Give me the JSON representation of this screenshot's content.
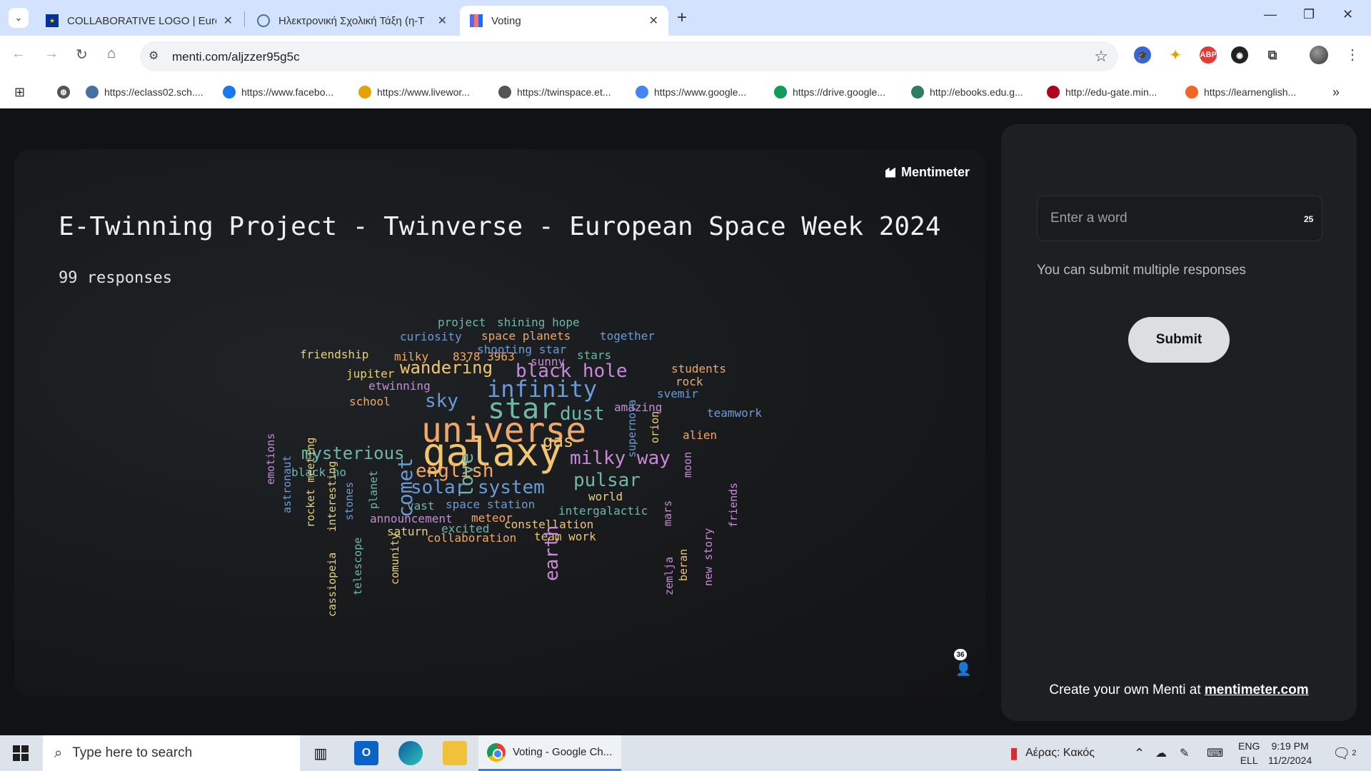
{
  "browser": {
    "tabs": [
      {
        "title": "COLLABORATIVE LOGO | Europ",
        "favicon": "eu-flag-icon",
        "active": false
      },
      {
        "title": "Ηλεκτρονική Σχολική Τάξη (η-Τ",
        "favicon": "eclass-icon",
        "active": false
      },
      {
        "title": "Voting",
        "favicon": "mentimeter-icon",
        "active": true
      }
    ],
    "url": "menti.com/aljzzer95g5c",
    "bookmarks": [
      {
        "label": "https://eclass02.sch....",
        "icon": "eclass-icon",
        "color": "#4a6fa5"
      },
      {
        "label": "https://www.facebo...",
        "icon": "facebook-icon",
        "color": "#1877f2"
      },
      {
        "label": "https://www.livewor...",
        "icon": "liveworksheets-icon",
        "color": "#e5a100"
      },
      {
        "label": "https://twinspace.et...",
        "icon": "twinspace-icon",
        "color": "#555555"
      },
      {
        "label": "https://www.google...",
        "icon": "google-icon",
        "color": "#4285f4"
      },
      {
        "label": "https://drive.google...",
        "icon": "drive-icon",
        "color": "#0f9d58"
      },
      {
        "label": "http://ebooks.edu.g...",
        "icon": "ebooks-icon",
        "color": "#2e7d60"
      },
      {
        "label": "http://edu-gate.min...",
        "icon": "edugate-icon",
        "color": "#b00020"
      },
      {
        "label": "https://learnenglish...",
        "icon": "learnenglish-icon",
        "color": "#f26522"
      }
    ]
  },
  "menti": {
    "logo": "Mentimeter",
    "question": "E-Twinning Project - Twinverse - European Space Week 2024",
    "responses": "99 responses",
    "audience_count": "36",
    "input_placeholder": "Enter a word",
    "char_limit": "25",
    "hint": "You can submit multiple responses",
    "submit": "Submit",
    "create_prefix": "Create your own Menti at ",
    "create_link": "mentimeter.com"
  },
  "wordcloud": [
    {
      "t": "project",
      "c": "#6fb8a8",
      "s": 16
    },
    {
      "t": "shining hope",
      "c": "#6fb8a8",
      "s": 16
    },
    {
      "t": "space planets",
      "c": "#f0a868",
      "s": 16
    },
    {
      "t": "curiosity",
      "c": "#6a9bd8",
      "s": 16
    },
    {
      "t": "together",
      "c": "#6a9bd8",
      "s": 16
    },
    {
      "t": "shooting star",
      "c": "#6a9bd8",
      "s": 16
    },
    {
      "t": "friendship",
      "c": "#e8d07a",
      "s": 16
    },
    {
      "t": "milky",
      "c": "#f0a868",
      "s": 16
    },
    {
      "t": "8378 3963",
      "c": "#f0a868",
      "s": 16
    },
    {
      "t": "sunny",
      "c": "#c88ad8",
      "s": 16
    },
    {
      "t": "stars",
      "c": "#6fb8a8",
      "s": 16
    },
    {
      "t": "jupiter",
      "c": "#e8d07a",
      "s": 16
    },
    {
      "t": "wandering",
      "c": "#f2c66e",
      "s": 24
    },
    {
      "t": "black hole",
      "c": "#c88ad8",
      "s": 26
    },
    {
      "t": "students",
      "c": "#f0a868",
      "s": 16
    },
    {
      "t": "etwinning",
      "c": "#c88ad8",
      "s": 16
    },
    {
      "t": "infinity",
      "c": "#6a9bd8",
      "s": 32
    },
    {
      "t": "rock",
      "c": "#f0a868",
      "s": 16
    },
    {
      "t": "svemir",
      "c": "#6a9bd8",
      "s": 16
    },
    {
      "t": "school",
      "c": "#f0a868",
      "s": 16
    },
    {
      "t": "sky",
      "c": "#6a9bd8",
      "s": 26
    },
    {
      "t": "star",
      "c": "#6fb8a8",
      "s": 40
    },
    {
      "t": "amazing",
      "c": "#c88ad8",
      "s": 16
    },
    {
      "t": "dust",
      "c": "#6fb8a8",
      "s": 26
    },
    {
      "t": "teamwork",
      "c": "#6a9bd8",
      "s": 16
    },
    {
      "t": "universe",
      "c": "#f0a868",
      "s": 48
    },
    {
      "t": "gas",
      "c": "#f2c66e",
      "s": 24
    },
    {
      "t": "alien",
      "c": "#f0a868",
      "s": 16
    },
    {
      "t": "galaxy",
      "c": "#f2c66e",
      "s": 54
    },
    {
      "t": "mysterious",
      "c": "#6fb8a8",
      "s": 24
    },
    {
      "t": "milky way",
      "c": "#c88ad8",
      "s": 26
    },
    {
      "t": "english",
      "c": "#f0a868",
      "s": 26
    },
    {
      "t": "black ho",
      "c": "#6fb8a8",
      "s": 16
    },
    {
      "t": "pulsar",
      "c": "#6fb8a8",
      "s": 26
    },
    {
      "t": "solar system",
      "c": "#6a9bd8",
      "s": 26
    },
    {
      "t": "world",
      "c": "#e8d07a",
      "s": 16
    },
    {
      "t": "space station",
      "c": "#6a9bd8",
      "s": 16
    },
    {
      "t": "vast",
      "c": "#6fb8a8",
      "s": 16
    },
    {
      "t": "intergalactic",
      "c": "#6fb8a8",
      "s": 16
    },
    {
      "t": "announcement",
      "c": "#c88ad8",
      "s": 16
    },
    {
      "t": "meteor",
      "c": "#f0a868",
      "s": 16
    },
    {
      "t": "excited",
      "c": "#6fb8a8",
      "s": 16
    },
    {
      "t": "constellation",
      "c": "#f2c66e",
      "s": 16
    },
    {
      "t": "saturn",
      "c": "#e8d07a",
      "s": 16
    },
    {
      "t": "team work",
      "c": "#f2c66e",
      "s": 16
    },
    {
      "t": "collaboration",
      "c": "#f0a868",
      "s": 16
    },
    {
      "t": "emotions",
      "c": "#c88ad8",
      "s": 15,
      "v": true
    },
    {
      "t": "astronaut",
      "c": "#6a9bd8",
      "s": 15,
      "v": true
    },
    {
      "t": "rocket meeting",
      "c": "#e8d07a",
      "s": 15,
      "v": true
    },
    {
      "t": "interesting",
      "c": "#e8d07a",
      "s": 15,
      "v": true
    },
    {
      "t": "stones",
      "c": "#6a9bd8",
      "s": 15,
      "v": true
    },
    {
      "t": "planet",
      "c": "#6fb8a8",
      "s": 15,
      "v": true
    },
    {
      "t": "comet",
      "c": "#6a9bd8",
      "s": 28,
      "v": true
    },
    {
      "t": "love",
      "c": "#6fb8a8",
      "s": 26,
      "v": true
    },
    {
      "t": "supernova",
      "c": "#6a9bd8",
      "s": 15,
      "v": true
    },
    {
      "t": "orion",
      "c": "#e8d07a",
      "s": 15,
      "v": true
    },
    {
      "t": "moon",
      "c": "#c88ad8",
      "s": 15,
      "v": true
    },
    {
      "t": "mars",
      "c": "#c88ad8",
      "s": 15,
      "v": true
    },
    {
      "t": "friends",
      "c": "#c88ad8",
      "s": 15,
      "v": true
    },
    {
      "t": "earth",
      "c": "#c88ad8",
      "s": 26,
      "v": true
    },
    {
      "t": "beran",
      "c": "#f2c66e",
      "s": 15,
      "v": true
    },
    {
      "t": "new story",
      "c": "#c88ad8",
      "s": 15,
      "v": true
    },
    {
      "t": "zemlja",
      "c": "#c88ad8",
      "s": 15,
      "v": true
    },
    {
      "t": "cassiopeia",
      "c": "#e8d07a",
      "s": 15,
      "v": true
    },
    {
      "t": "telescope",
      "c": "#6fb8a8",
      "s": 15,
      "v": true
    },
    {
      "t": "comunity",
      "c": "#e8d07a",
      "s": 15,
      "v": true
    }
  ],
  "taskbar": {
    "search_placeholder": "Type here to search",
    "active_app": "Voting - Google Ch...",
    "weather": "Αέρας: Κακός",
    "lang_top": "ENG",
    "lang_bottom": "ELL",
    "time": "9:19 PM",
    "date": "11/2/2024",
    "notifications": "2"
  }
}
